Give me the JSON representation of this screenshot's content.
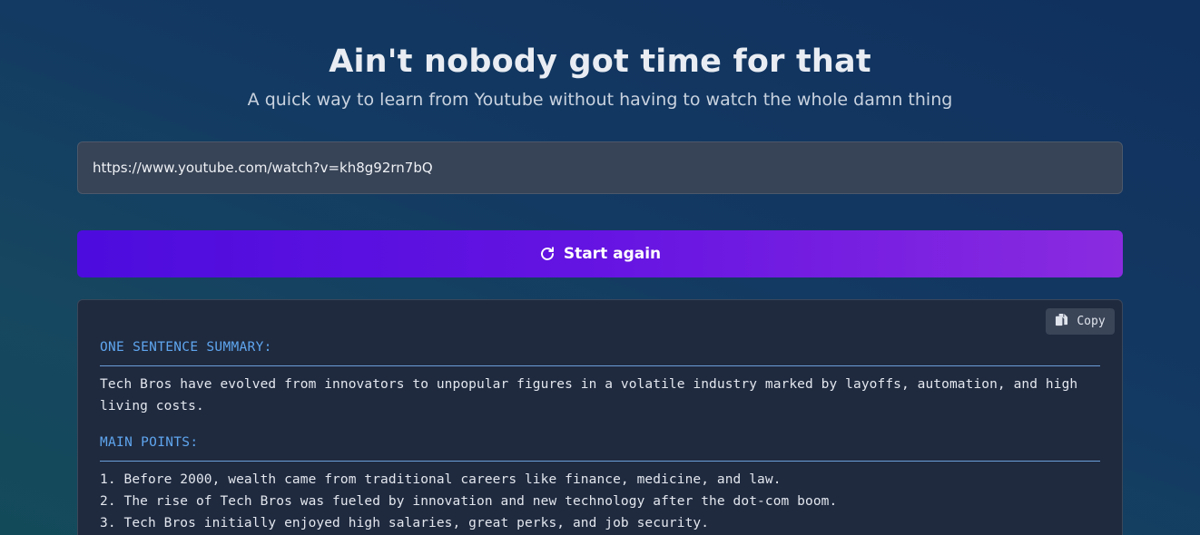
{
  "header": {
    "title": "Ain't nobody got time for that",
    "subtitle": "A quick way to learn from Youtube without having to watch the whole damn thing"
  },
  "input": {
    "value": "https://www.youtube.com/watch?v=kh8g92rn7bQ"
  },
  "start_button": {
    "label": "Start again",
    "icon": "refresh-icon"
  },
  "result": {
    "copy_label": "Copy",
    "copy_icon": "copy-icon",
    "summary_heading": "ONE SENTENCE SUMMARY:",
    "summary_text": "Tech Bros have evolved from innovators to unpopular figures in a volatile industry marked by layoffs, automation, and high living costs.",
    "points_heading": "MAIN POINTS:",
    "points": [
      "1. Before 2000, wealth came from traditional careers like finance, medicine, and law.",
      "2. The rise of Tech Bros was fueled by innovation and new technology after the dot-com boom.",
      "3. Tech Bros initially enjoyed high salaries, great perks, and job security."
    ]
  },
  "colors": {
    "accent_start": "#4c0cdd",
    "accent_end": "#8a2be0",
    "heading_blue": "#5fa6ef"
  }
}
